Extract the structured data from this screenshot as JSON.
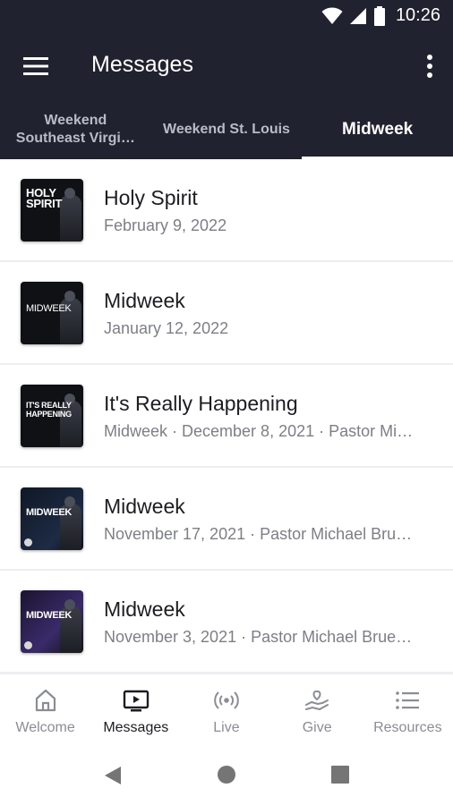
{
  "status_bar": {
    "time": "10:26",
    "icons": [
      "wifi-icon",
      "signal-icon",
      "battery-icon"
    ]
  },
  "app_bar": {
    "title": "Messages",
    "menu_icon": "hamburger-menu-icon",
    "more_icon": "more-vert-icon"
  },
  "tabs": [
    {
      "label": "Weekend Southeast Virgi…",
      "active": false
    },
    {
      "label": "Weekend St. Louis",
      "active": false
    },
    {
      "label": "Midweek",
      "active": true
    }
  ],
  "messages": [
    {
      "title": "Holy Spirit",
      "subtitle": "February 9, 2022",
      "thumb_text": "HOLY SPIRIT"
    },
    {
      "title": "Midweek",
      "subtitle": "January 12, 2022",
      "thumb_text": "MIDWEEK"
    },
    {
      "title": "It's Really Happening",
      "subtitle": "Midweek · December 8, 2021 · Pastor Mi…",
      "thumb_text": "IT'S REALLY HAPPENING"
    },
    {
      "title": "Midweek",
      "subtitle": "November 17, 2021 · Pastor Michael Bru…",
      "thumb_text": "MIDWEEK"
    },
    {
      "title": "Midweek",
      "subtitle": "November 3, 2021 · Pastor Michael Brue…",
      "thumb_text": "MIDWEEK"
    }
  ],
  "bottom_nav": [
    {
      "label": "Welcome",
      "icon": "home-icon",
      "active": false
    },
    {
      "label": "Messages",
      "icon": "tv-play-icon",
      "active": true
    },
    {
      "label": "Live",
      "icon": "broadcast-icon",
      "active": false
    },
    {
      "label": "Give",
      "icon": "hand-heart-icon",
      "active": false
    },
    {
      "label": "Resources",
      "icon": "list-icon",
      "active": false
    }
  ],
  "system_nav": [
    "back-icon",
    "home-circle-icon",
    "recents-icon"
  ],
  "colors": {
    "header_bg": "#20232f",
    "tab_inactive": "#b9bcc4",
    "title_text": "#1c1d21",
    "subtitle_text": "#7c7f86"
  }
}
